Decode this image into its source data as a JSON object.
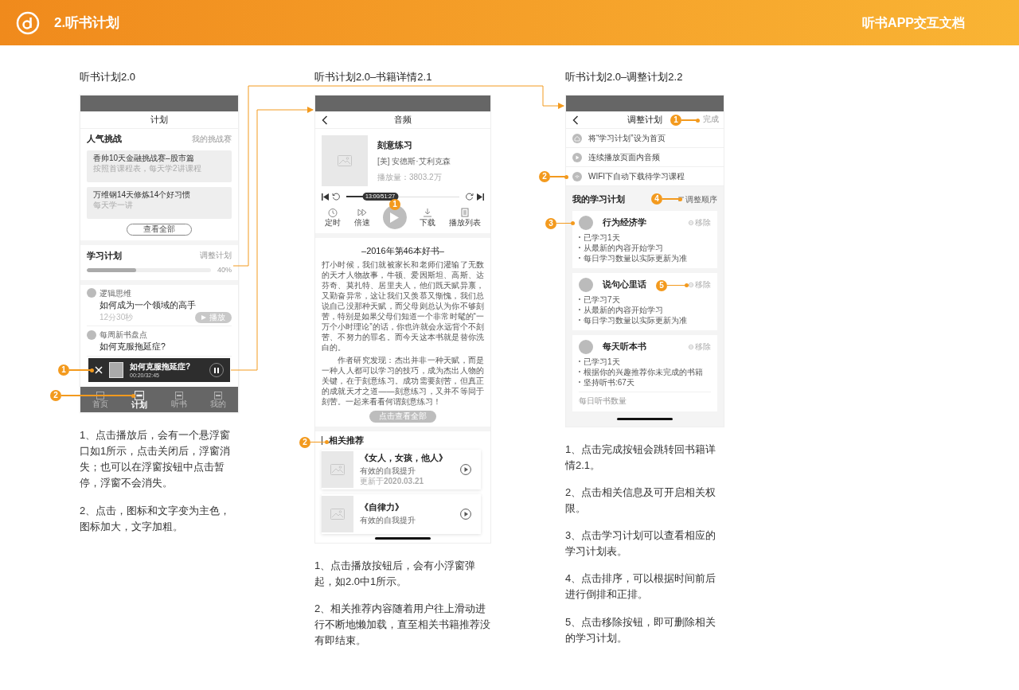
{
  "header": {
    "title": "2.听书计划",
    "doc_title": "听书APP交互文档"
  },
  "plan_screen": {
    "caption": "听书计划2.0",
    "nav_title": "计划",
    "challenge": {
      "title": "人气挑战",
      "link": "我的挑战赛",
      "more": "查看全部",
      "cards": [
        {
          "title": "香帅10天金融挑战赛–股市篇",
          "subtitle": "按照首课程表，每天学2讲课程"
        },
        {
          "title": "万维钢14天修炼14个好习惯",
          "subtitle": "每天学一讲"
        }
      ]
    },
    "study": {
      "title": "学习计划",
      "link": "调整计划",
      "level": 0.4,
      "percent": "40%"
    },
    "lessons": [
      {
        "source": "逻辑思维",
        "title": "如何成为一个领域的高手",
        "duration": "12分30秒",
        "play": "播放"
      },
      {
        "source": "每周新书盘点",
        "title": "如何克服拖延症?"
      }
    ],
    "mini_player": {
      "title": "如何克服拖延症?",
      "time": "00:20/32:45",
      "playing": true
    },
    "tabs": [
      {
        "label": "首页",
        "selected": false
      },
      {
        "label": "计划",
        "selected": true
      },
      {
        "label": "听书",
        "selected": false
      },
      {
        "label": "我的",
        "selected": false
      }
    ],
    "callouts": [
      "1",
      "2"
    ],
    "notes": [
      "1、点击播放后，会有一个悬浮窗口如1所示，点击关闭后，浮窗消失；也可以在浮窗按钮中点击暂停，浮窗不会消失。",
      "2、点击，图标和文字变为主色，图标加大，文字加粗。"
    ]
  },
  "detail_screen": {
    "caption": "听书计划2.0–书籍详情2.1",
    "nav_title": "音频",
    "book": {
      "title": "刻意练习",
      "author": "[美] 安德斯·艾利克森",
      "plays": "播放量：3803.2万"
    },
    "player": {
      "time": "13:00/51:27",
      "level": 0.3,
      "playing": false
    },
    "controls": [
      {
        "label": "定时",
        "kind": "timer"
      },
      {
        "label": "倍速",
        "kind": "speed"
      },
      {
        "label": "下载",
        "kind": "download"
      },
      {
        "label": "播放列表",
        "kind": "list"
      }
    ],
    "intro": {
      "heading": "–2016年第46本好书–",
      "paragraphs": [
        "打小时候，我们就被家长和老师们灌输了无数的天才人物故事，牛顿、爱因斯坦、高斯、达芬奇、莫扎特、居里夫人，他们既天赋异禀，又勤奋异常，这让我们又羡慕又惭愧，我们总说自己没那种天赋，而父母则总认为你不够刻苦，特别是如果父母们知道一个非常时髦的“一万个小时理论”的话，你也许就会永远背个不刻苦、不努力的罪名。而今天这本书就是替你洗白的。",
        "作者研究发现：杰出并非一种天赋，而是一种人人都可以学习的技巧，成为杰出人物的关键，在于刻意练习。成功需要刻苦，但真正的成就天才之道——刻意练习，又并不等同于刻苦。一起来看看何谓刻意练习！"
      ],
      "more": "点击查看全部"
    },
    "related": {
      "title": "相关推荐",
      "books": [
        {
          "title": "《女人，女孩，他人》",
          "subtitle": "有效的自我提升",
          "date": "更新于**2020.03.21**"
        },
        {
          "title": "《自律力》",
          "subtitle": "有效的自我提升"
        }
      ]
    },
    "callouts": [
      "1",
      "2"
    ],
    "notes": [
      "1、点击播放按钮后，会有小浮窗弹起，如2.0中1所示。",
      "2、相关推荐内容随着用户往上滑动进行不断地懒加载，直至相关书籍推荐没有即结束。"
    ]
  },
  "adjust_screen": {
    "caption": "听书计划2.0–调整计划2.2",
    "nav_title": "调整计划",
    "done": "完成",
    "settings": [
      {
        "label": "将“学习计划”设为首页",
        "kind": "home"
      },
      {
        "label": "连续播放页面内音频",
        "kind": "play"
      },
      {
        "label": "WIFI下自动下载待学习课程",
        "kind": "wifi"
      }
    ],
    "plans_title": "我的学习计划",
    "sort": "调整顺序",
    "plans": [
      {
        "title": "行为经济学",
        "remove": "移除",
        "bullets": [
          "已学习1天",
          "从最新的内容开始学习",
          "每日学习数量以实际更新为准"
        ]
      },
      {
        "title": "说句心里话",
        "remove": "移除",
        "bullets": [
          "已学习7天",
          "从最新的内容开始学习",
          "每日学习数量以实际更新为准"
        ]
      },
      {
        "title": "每天听本书",
        "remove": "移除",
        "bullets": [
          "已学习1天",
          "根据你的兴趣推荐你未完成的书籍",
          "坚持听书:67天"
        ],
        "footer": "每日听书数量"
      }
    ],
    "callouts": [
      "1",
      "2",
      "3",
      "4",
      "5"
    ],
    "notes": [
      "1、点击完成按钮会跳转回书籍详情2.1。",
      "2、点击相关信息及可开启相关权限。",
      "3、点击学习计划可以查看相应的学习计划表。",
      "4、点击排序，可以根据时间前后进行倒排和正排。",
      "5、点击移除按钮，即可删除相关的学习计划。"
    ]
  }
}
